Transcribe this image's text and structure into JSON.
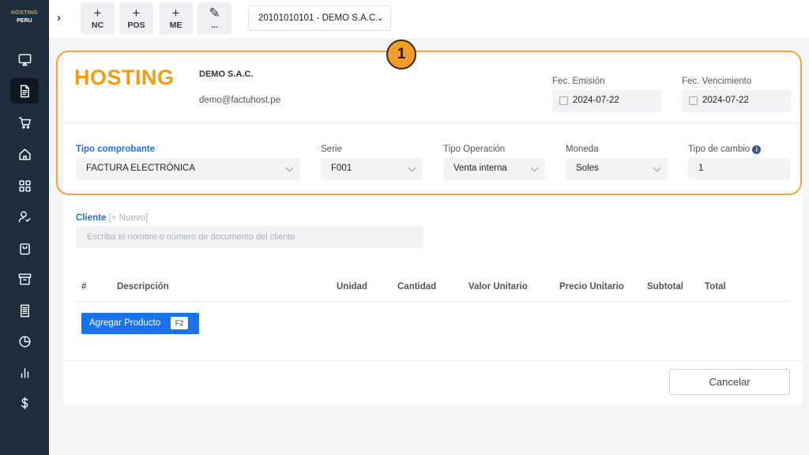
{
  "sidebar": {
    "logo_line1": "HOSTING",
    "logo_line2": "PERU",
    "items": [
      {
        "icon": "monitor-icon"
      },
      {
        "icon": "document-icon",
        "active": true
      },
      {
        "icon": "cart-icon"
      },
      {
        "icon": "home-icon"
      },
      {
        "icon": "grid-icon"
      },
      {
        "icon": "user-check-icon"
      },
      {
        "icon": "bag-icon"
      },
      {
        "icon": "archive-icon"
      },
      {
        "icon": "receipt-icon"
      },
      {
        "icon": "pie-chart-icon"
      },
      {
        "icon": "bar-chart-icon"
      },
      {
        "icon": "dollar-icon"
      }
    ]
  },
  "topbar": {
    "expand_glyph": "›",
    "quick_buttons": [
      {
        "plus": "+",
        "label": "NC"
      },
      {
        "plus": "+",
        "label": "POS"
      },
      {
        "plus": "+",
        "label": "ME"
      },
      {
        "plus": "✎",
        "label": "..."
      }
    ],
    "company_selector": "20101010101 - DEMO S.A.C."
  },
  "annotation": {
    "badge": "1",
    "color": "#f0a23b"
  },
  "header": {
    "brand": "HOSTING",
    "company_name": "DEMO S.A.C.",
    "company_email": "demo@factuhost.pe",
    "emission_label": "Fec. Emisión",
    "emission_value": "2024-07-22",
    "due_label": "Fec. Vencimiento",
    "due_value": "2024-07-22"
  },
  "fields": {
    "doc_type_label": "Tipo comprobante",
    "doc_type_value": "FACTURA ELECTRÓNICA",
    "series_label": "Serie",
    "series_value": "F001",
    "operation_label": "Tipo Operación",
    "operation_value": "Venta interna",
    "currency_label": "Moneda",
    "currency_value": "Soles",
    "exchange_label": "Tipo de cambio",
    "exchange_value": "1"
  },
  "client": {
    "label": "Cliente",
    "new_link": "[+ Nuevo]",
    "placeholder": "Escriba el nombre o número de documento del cliente"
  },
  "table": {
    "columns": [
      "#",
      "Descripción",
      "Unidad",
      "Cantidad",
      "Valor Unitario",
      "Precio Unitario",
      "Subtotal",
      "Total"
    ]
  },
  "actions": {
    "add_product": "Agregar Producto",
    "add_product_shortcut": "F2",
    "cancel": "Cancelar"
  },
  "colors": {
    "accent": "#1a73e8",
    "brand": "#f39c12",
    "sidebar": "#1f2d3d"
  }
}
